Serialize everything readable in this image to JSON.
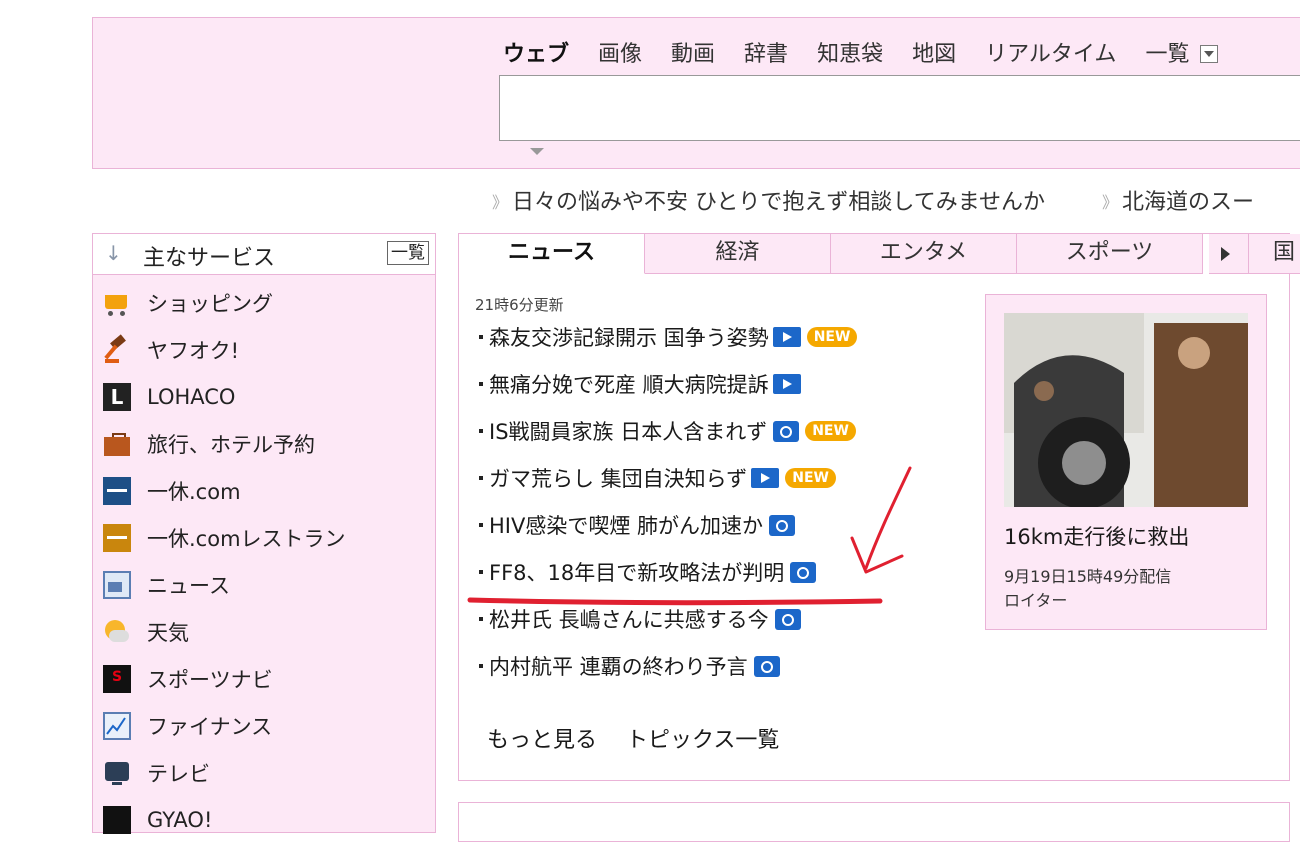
{
  "search": {
    "tabs": [
      "ウェブ",
      "画像",
      "動画",
      "辞書",
      "知恵袋",
      "地図",
      "リアルタイム"
    ],
    "more_label": "一覧",
    "query_value": ""
  },
  "ticker": {
    "items": [
      "日々の悩みや不安 ひとりで抱えず相談してみませんか",
      "北海道のスー"
    ]
  },
  "services": {
    "title": "主なサービス",
    "list_button": "一覧",
    "items": [
      {
        "label": "ショッピング",
        "icon": "cart-icon"
      },
      {
        "label": "ヤフオク!",
        "icon": "auction-hammer-icon"
      },
      {
        "label": "LOHACO",
        "icon": "lohaco-icon"
      },
      {
        "label": "旅行、ホテル予約",
        "icon": "suitcase-icon"
      },
      {
        "label": "一休.com",
        "icon": "ikyu-icon"
      },
      {
        "label": "一休.comレストラン",
        "icon": "ikyu-restaurant-icon"
      },
      {
        "label": "ニュース",
        "icon": "news-icon"
      },
      {
        "label": "天気",
        "icon": "weather-icon"
      },
      {
        "label": "スポーツナビ",
        "icon": "sports-icon"
      },
      {
        "label": "ファイナンス",
        "icon": "finance-chart-icon"
      },
      {
        "label": "テレビ",
        "icon": "tv-icon"
      },
      {
        "label": "GYAO!",
        "icon": "gyao-icon"
      }
    ]
  },
  "news": {
    "tabs": [
      "ニュース",
      "経済",
      "エンタメ",
      "スポーツ"
    ],
    "tab_cut_label": "国",
    "updated": "21時6分更新",
    "headlines": [
      {
        "text": "森友交渉記録開示 国争う姿勢",
        "badge": "video",
        "new": true
      },
      {
        "text": "無痛分娩で死産 順大病院提訴",
        "badge": "video",
        "new": false
      },
      {
        "text": "IS戦闘員家族 日本人含まれず",
        "badge": "photo",
        "new": true
      },
      {
        "text": "ガマ荒らし 集団自決知らず",
        "badge": "video",
        "new": true
      },
      {
        "text": "HIV感染で喫煙 肺がん加速か",
        "badge": "photo",
        "new": false
      },
      {
        "text": "FF8、18年目で新攻略法が判明",
        "badge": "photo",
        "new": false
      },
      {
        "text": "松井氏 長嶋さんに共感する今",
        "badge": "photo",
        "new": false
      },
      {
        "text": "内村航平 連覇の終わり予言",
        "badge": "photo",
        "new": false
      }
    ],
    "new_label": "NEW",
    "more_label": "もっと見る",
    "topics_label": "トピックス一覧",
    "featured": {
      "caption": "16km走行後に救出",
      "date": "9月19日15時49分配信",
      "source": "ロイター"
    }
  },
  "colors": {
    "pink_bg": "#fde8f6",
    "pink_border": "#eab3d7",
    "accent_blue": "#1c67c9",
    "new_badge": "#f5a800",
    "annotation_red": "#e02030"
  }
}
